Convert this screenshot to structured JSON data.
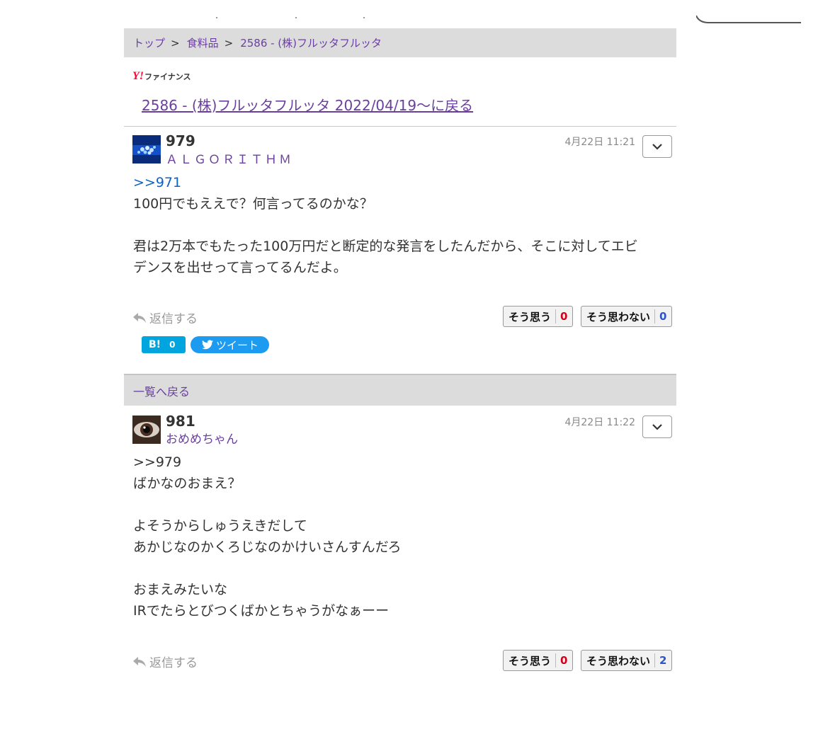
{
  "breadcrumb": {
    "top": "トップ",
    "category": "食料品",
    "current": "2586 - (株)フルッタフルッタ",
    "separator": ">"
  },
  "brand": {
    "logo_y": "Y!",
    "logo_text": "ファイナンス"
  },
  "back_link": "2586 - (株)フルッタフルッタ 2022/04/19～に戻る",
  "posts": [
    {
      "number": "979",
      "author": "ＡＬＧＯＲＩＴＨＭ",
      "timestamp": "4月22日 11:21",
      "reply_to": ">>971",
      "lines": [
        "100円でもええで？何言ってるのかな？",
        "",
        "君は2万本でもたった100万円だと断定的な発言をしたんだから、そこに対してエビ",
        "デンスを出せって言ってるんだよ。"
      ],
      "reply_label": "返信する",
      "agree_label": "そう思う",
      "agree_count": "0",
      "disagree_label": "そう思わない",
      "disagree_count": "0",
      "hatena_label": "B!",
      "hatena_count": "0",
      "tweet_label": "ツイート"
    },
    {
      "number": "981",
      "author": "おめめちゃん",
      "timestamp": "4月22日 11:22",
      "reply_to": ">>979",
      "lines": [
        "ばかなのおまえ？",
        "",
        "よそうからしゅうえきだして",
        "あかじなのかくろじなのかけいさんすんだろ",
        "",
        "おまえみたいな",
        "IRでたらとびつくばかとちゃうがなぁーー"
      ],
      "reply_label": "返信する",
      "agree_label": "そう思う",
      "agree_count": "0",
      "disagree_label": "そう思わない",
      "disagree_count": "2"
    }
  ],
  "list_back": "一覧へ戻る",
  "colors": {
    "link_purple": "#6b3fa0",
    "reply_blue": "#0b63c5",
    "agree_red": "#d0021b",
    "disagree_blue": "#2e55c7",
    "hatena_blue": "#00a4de",
    "twitter_blue": "#1d9bf0"
  },
  "icons": [
    "chevron-down-icon",
    "reply-arrow-icon",
    "twitter-bird-icon"
  ]
}
